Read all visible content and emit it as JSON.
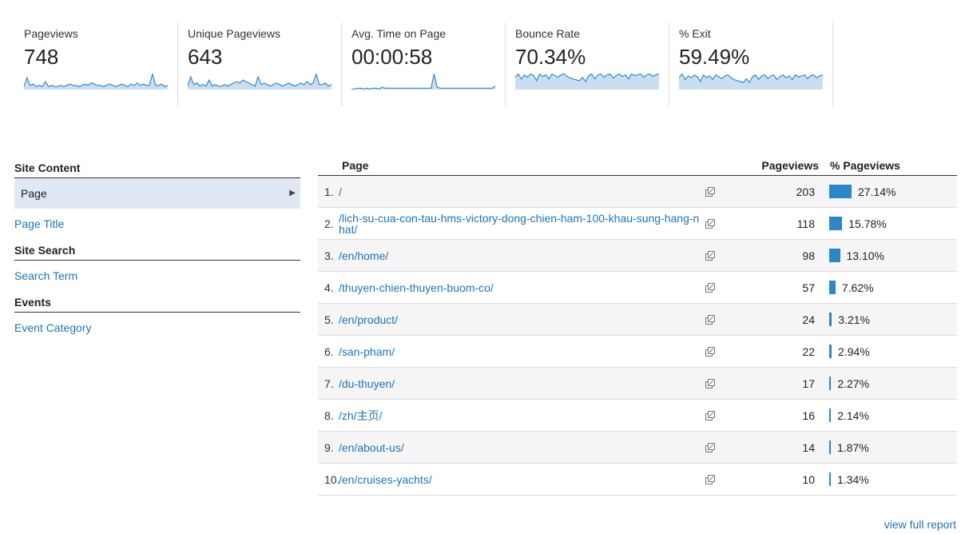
{
  "metrics": [
    {
      "label": "Pageviews",
      "value": "748",
      "trend": [
        2,
        9,
        3,
        4,
        2,
        3,
        2,
        6,
        2,
        3,
        2,
        2,
        3,
        2,
        3,
        4,
        3,
        3,
        2,
        3,
        4,
        3,
        5,
        4,
        3,
        3,
        2,
        3,
        4,
        3,
        2,
        3,
        4,
        3,
        2,
        4,
        3,
        5,
        3,
        4,
        3,
        3,
        12,
        3,
        3,
        4,
        2,
        3
      ],
      "trend_color": "#3b87c6"
    },
    {
      "label": "Unique Pageviews",
      "value": "643",
      "trend": [
        2,
        8,
        3,
        4,
        2,
        3,
        2,
        6,
        2,
        3,
        2,
        2,
        3,
        2,
        3,
        4,
        5,
        4,
        6,
        5,
        4,
        3,
        2,
        8,
        3,
        4,
        3,
        2,
        3,
        4,
        3,
        2,
        3,
        4,
        3,
        2,
        3,
        4,
        3,
        5,
        3,
        4,
        10,
        3,
        3,
        4,
        2,
        3
      ],
      "trend_color": "#3b87c6"
    },
    {
      "label": "Avg. Time on Page",
      "value": "00:00:58",
      "trend": [
        0,
        0,
        1,
        1,
        0,
        1,
        0,
        1,
        1,
        0,
        2,
        1,
        1,
        1,
        1,
        1,
        1,
        1,
        1,
        1,
        1,
        1,
        1,
        1,
        1,
        1,
        1,
        16,
        2,
        1,
        1,
        1,
        1,
        1,
        1,
        1,
        1,
        1,
        1,
        1,
        1,
        1,
        1,
        1,
        1,
        1,
        1,
        3
      ],
      "trend_color": "#3b87c6"
    },
    {
      "label": "Bounce Rate",
      "value": "70.34%",
      "trend": [
        14,
        18,
        12,
        17,
        14,
        18,
        16,
        10,
        18,
        15,
        17,
        12,
        18,
        16,
        14,
        17,
        18,
        15,
        13,
        12,
        11,
        10,
        14,
        9,
        16,
        18,
        12,
        17,
        18,
        14,
        17,
        18,
        13,
        16,
        18,
        15,
        17,
        12,
        18,
        16,
        17,
        18,
        14,
        17,
        18,
        15,
        17,
        18
      ],
      "trend_color": "#3b87c6"
    },
    {
      "label": "% Exit",
      "value": "59.49%",
      "trend": [
        12,
        16,
        10,
        14,
        12,
        15,
        13,
        8,
        15,
        12,
        14,
        10,
        15,
        13,
        11,
        14,
        15,
        12,
        10,
        9,
        8,
        7,
        11,
        7,
        13,
        15,
        10,
        14,
        15,
        11,
        14,
        15,
        10,
        13,
        15,
        12,
        14,
        10,
        15,
        13,
        14,
        15,
        11,
        14,
        15,
        12,
        14,
        15
      ],
      "trend_color": "#3b87c6"
    }
  ],
  "nav": {
    "site_content_heading": "Site Content",
    "page_item": "Page",
    "page_title_item": "Page Title",
    "site_search_heading": "Site Search",
    "search_term_item": "Search Term",
    "events_heading": "Events",
    "event_category_item": "Event Category"
  },
  "table": {
    "col_page": "Page",
    "col_pageviews": "Pageviews",
    "col_pct": "% Pageviews",
    "rows": [
      {
        "idx": "1.",
        "page": "/",
        "pageviews": "203",
        "pct": "27.14%",
        "pct_value": 27.14
      },
      {
        "idx": "2.",
        "page": "/lich-su-cua-con-tau-hms-victory-dong-chien-ham-100-khau-sung-hang-nhat/",
        "pageviews": "118",
        "pct": "15.78%",
        "pct_value": 15.78
      },
      {
        "idx": "3.",
        "page": "/en/home/",
        "pageviews": "98",
        "pct": "13.10%",
        "pct_value": 13.1
      },
      {
        "idx": "4.",
        "page": "/thuyen-chien-thuyen-buom-co/",
        "pageviews": "57",
        "pct": "7.62%",
        "pct_value": 7.62
      },
      {
        "idx": "5.",
        "page": "/en/product/",
        "pageviews": "24",
        "pct": "3.21%",
        "pct_value": 3.21
      },
      {
        "idx": "6.",
        "page": "/san-pham/",
        "pageviews": "22",
        "pct": "2.94%",
        "pct_value": 2.94
      },
      {
        "idx": "7.",
        "page": "/du-thuyen/",
        "pageviews": "17",
        "pct": "2.27%",
        "pct_value": 2.27
      },
      {
        "idx": "8.",
        "page": "/zh/主页/",
        "pageviews": "16",
        "pct": "2.14%",
        "pct_value": 2.14
      },
      {
        "idx": "9.",
        "page": "/en/about-us/",
        "pageviews": "14",
        "pct": "1.87%",
        "pct_value": 1.87
      },
      {
        "idx": "10.",
        "page": "/en/cruises-yachts/",
        "pageviews": "10",
        "pct": "1.34%",
        "pct_value": 1.34
      }
    ]
  },
  "view_full_report": "view full report",
  "icons": {
    "row_link_icon": "open-in-new-window-icon",
    "nav_caret": "caret-right-icon"
  }
}
